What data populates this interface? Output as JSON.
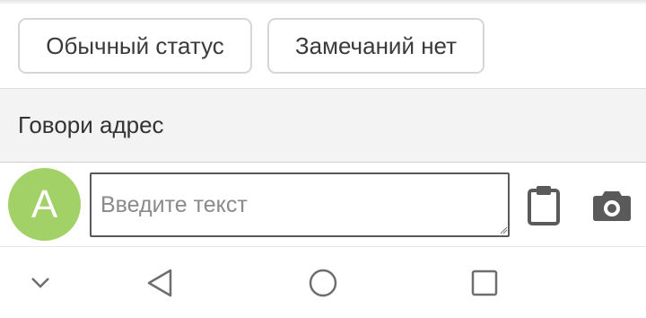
{
  "quick_replies": {
    "chip_1": "Обычный статус",
    "chip_2": "Замечаний нет"
  },
  "banner": {
    "text": "Говори адрес"
  },
  "composer": {
    "avatar_letter": "A",
    "avatar_color": "#a2d168",
    "input_value": "",
    "input_placeholder": "Введите текст",
    "attach_icon": "clipboard-icon",
    "camera_icon": "camera-icon"
  },
  "navigation_bar": {
    "icons": [
      "chevron-down-icon",
      "back-triangle-icon",
      "home-circle-icon",
      "recent-square-icon"
    ]
  }
}
